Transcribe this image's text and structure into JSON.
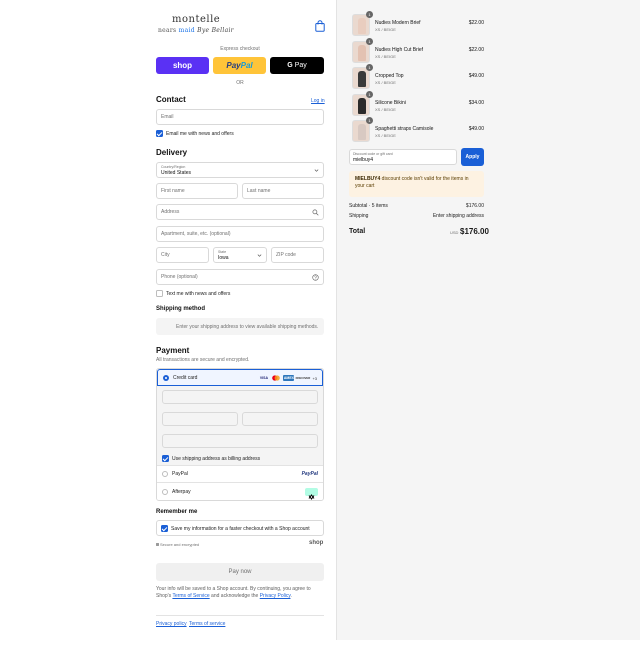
{
  "brand": {
    "logo_main": "montelle",
    "logo_sub_a": "nears",
    "logo_sub_b": "maid",
    "logo_sub_c": "Bye Bellair"
  },
  "express": {
    "label": "Express checkout",
    "shop_label": "shop",
    "paypal_label_a": "Pay",
    "paypal_label_b": "Pal",
    "gpay_label": "Pay",
    "gpay_g": "G",
    "or_label": "OR"
  },
  "contact": {
    "heading": "Contact",
    "login_link": "Log in",
    "email_placeholder": "Email",
    "newsletter_label": "Email me with news and offers",
    "newsletter_checked": true
  },
  "delivery": {
    "heading": "Delivery",
    "country_label": "Country/Region",
    "country_value": "United States",
    "first_name_placeholder": "First name",
    "last_name_placeholder": "Last name",
    "address_placeholder": "Address",
    "apartment_placeholder": "Apartment, suite, etc. (optional)",
    "city_placeholder": "City",
    "state_label": "State",
    "state_value": "Iowa",
    "zip_placeholder": "ZIP code",
    "phone_placeholder": "Phone (optional)",
    "text_me_label": "Text me with news and offers"
  },
  "shipping_method": {
    "heading": "Shipping method",
    "message": "Enter your shipping address to view available shipping methods."
  },
  "payment": {
    "heading": "Payment",
    "subtitle": "All transactions are secure and encrypted.",
    "credit_card_label": "Credit card",
    "brands": [
      "VISA",
      "MC",
      "AMEX",
      "DISCOVER"
    ],
    "more_brands": "+3",
    "billing_same_label": "Use shipping address as billing address",
    "paypal_label": "PayPal",
    "paypal_logo": "PayPal",
    "afterpay_label": "Afterpay"
  },
  "remember": {
    "heading": "Remember me",
    "save_label": "Save my information for a faster checkout with a Shop account",
    "secure_label": "Secure and encrypted",
    "shop_word": "shop"
  },
  "checkout": {
    "pay_now": "Pay now",
    "legal_a": "Your info will be saved to a Shop account. By continuing, you agree to Shop's ",
    "legal_terms": "Terms of Service",
    "legal_b": " and acknowledge the ",
    "legal_privacy": "Privacy Policy",
    "legal_c": "."
  },
  "footer": {
    "privacy_policy": "Privacy policy",
    "terms_of_service": "Terms of service"
  },
  "cart": {
    "items": [
      {
        "name": "Nudies Modern Brief",
        "variant": "XS / BEIGE",
        "price": "$22.00",
        "qty": "1",
        "color": "#e9cdbf"
      },
      {
        "name": "Nudies High Cut Brief",
        "variant": "XS / BEIGE",
        "price": "$22.00",
        "qty": "1",
        "color": "#e3c2b2"
      },
      {
        "name": "Cropped Top",
        "variant": "XS / BEIGE",
        "price": "$49.00",
        "qty": "1",
        "color": "#3a3a3a"
      },
      {
        "name": "Silicone Bikini",
        "variant": "XS / BEIGE",
        "price": "$34.00",
        "qty": "1",
        "color": "#2b2b2b"
      },
      {
        "name": "Spaghetti straps Camisole",
        "variant": "XS / BEIGE",
        "price": "$49.00",
        "qty": "1",
        "color": "#d8c9c2"
      }
    ],
    "discount_label": "Discount code or gift card",
    "discount_value": "mielbuy4",
    "apply_label": "Apply",
    "warning_code": "MIELBUY4",
    "warning_text": " discount code isn't valid for the items in your cart",
    "subtotal_label": "Subtotal · 5 items",
    "subtotal_value": "$176.00",
    "shipping_label": "Shipping",
    "shipping_value": "Enter shipping address",
    "total_label": "Total",
    "currency": "USD",
    "total_value": "$176.00"
  },
  "colors": {
    "accent": "#1a5fd6",
    "shop_purple": "#5a31f4",
    "paypal_yellow": "#ffc439",
    "warning_bg": "#fdf2e2"
  }
}
